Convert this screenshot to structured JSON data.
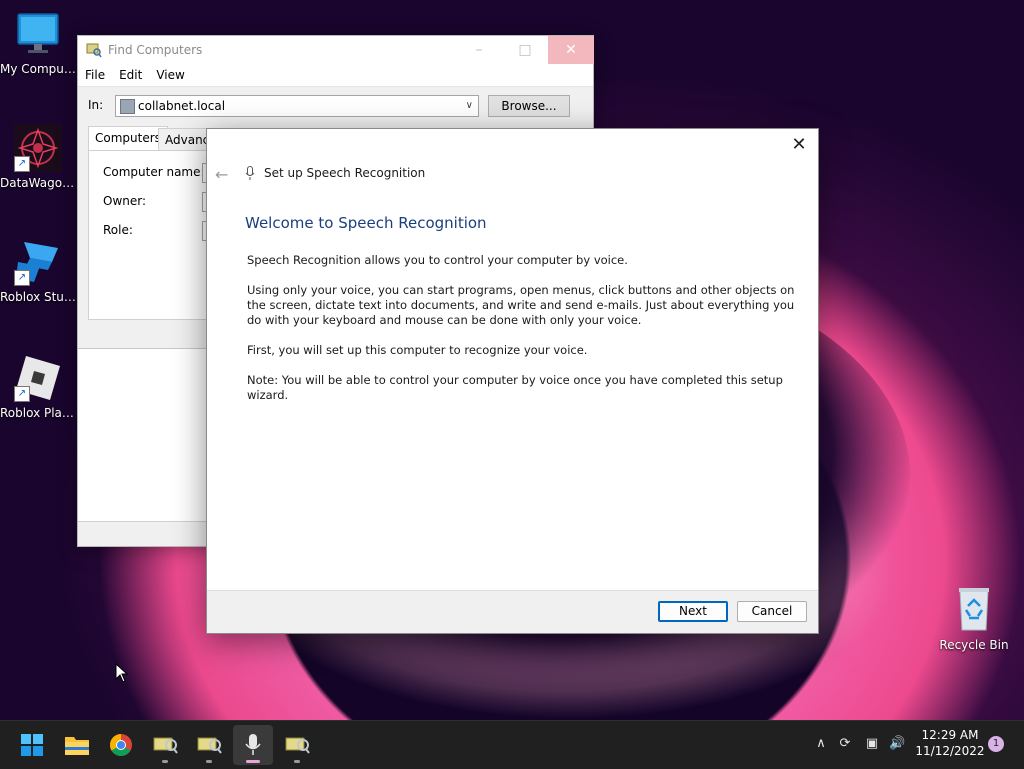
{
  "desktop": {
    "icons": [
      {
        "label": "My Computer"
      },
      {
        "label": "DataWagon..."
      },
      {
        "label": "Roblox Studio"
      },
      {
        "label": "Roblox Player"
      },
      {
        "label": "Recycle Bin"
      }
    ]
  },
  "find_window": {
    "title": "Find Computers",
    "menu": [
      "File",
      "Edit",
      "View"
    ],
    "in_label": "In:",
    "in_value": "collabnet.local",
    "browse_label": "Browse...",
    "tabs": [
      "Computers",
      "Advanced"
    ],
    "fields": [
      "Computer name:",
      "Owner:",
      "Role:"
    ]
  },
  "wizard": {
    "header": "Set up Speech Recognition",
    "heading": "Welcome to Speech Recognition",
    "paragraphs": [
      "Speech Recognition allows you to control your computer by voice.",
      "Using only your voice, you can start programs, open menus, click buttons and other objects on the screen, dictate text into documents, and write and send e-mails. Just about everything you do with your keyboard and mouse can be done with only your voice.",
      "First, you will set up this computer to recognize your voice.",
      "Note: You will be able to control your computer by voice once you have completed this setup wizard."
    ],
    "next_label": "Next",
    "cancel_label": "Cancel"
  },
  "taskbar": {
    "apps": [
      "start-icon",
      "file-explorer-icon",
      "chrome-icon",
      "find-computers-icon",
      "find-computers-icon",
      "microphone-icon",
      "find-computers-icon"
    ],
    "time": "12:29 AM",
    "date": "11/12/2022",
    "notification_count": "1"
  },
  "colors": {
    "accent": "#0067c0",
    "wizard_heading": "#1a3f7e",
    "taskbar": "#202020"
  }
}
